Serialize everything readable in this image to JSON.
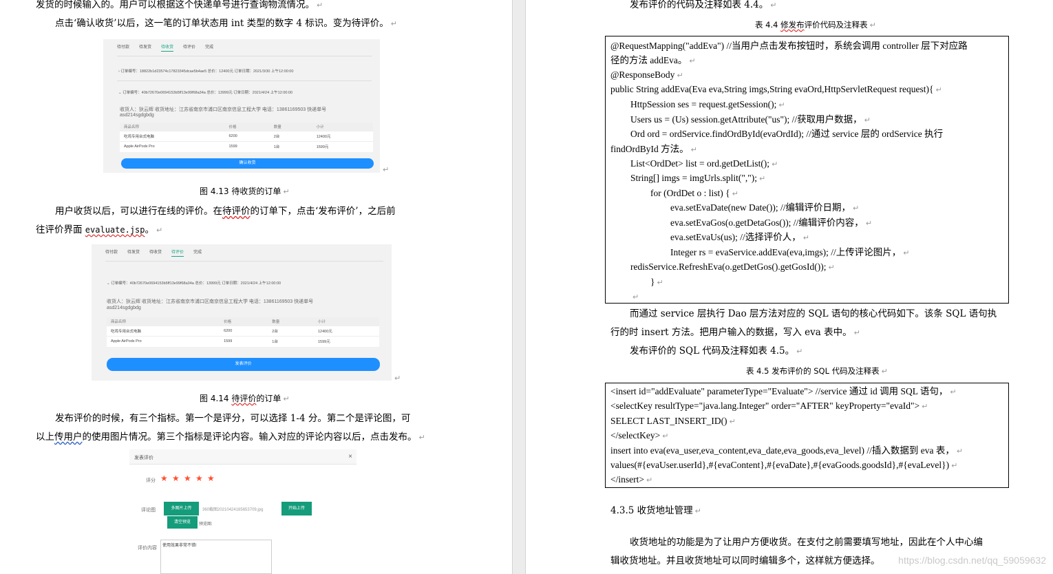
{
  "left": {
    "line1": "发货的时候输入的。用户可以根据这个快递单号进行查询物流情况。",
    "line2": "点击‘确认收货’以后，这一笔的订单状态用 int 类型的数字 4 标识。变为待评价。",
    "fig1": {
      "tabs": [
        "待付款",
        "待发货",
        "待收货",
        "待评价",
        "完成"
      ],
      "row1": "› 订单编号：18822b1d23574c17823345dcae5b4ae5  总价：12400元 订单日期：2021/3/30 上午12:00:00",
      "row2": "⌄ 订单编号：40b72670e0694153b5ff13e99f68a34a  总价：13999元 订单日期：2021/4/24 上午12:00:00",
      "addr1": "收货人：狄云辉  收货地址：江苏省南京市浦口区南京信息工程大学 电话：13861169503 快递单号",
      "addr2": "asd214sgdgbdg",
      "headers": [
        "商品名称",
        "价格",
        "数量",
        "小计"
      ],
      "rows": [
        [
          "吃鸡专用台式电脑",
          "6200",
          "2台",
          "12400元"
        ],
        [
          "Apple AirPods Pro",
          "1599",
          "1台",
          "1599元"
        ]
      ],
      "button": "确认收货"
    },
    "cap1": "图 4.13  待收货的订单",
    "line3": "用户收货以后，可以进行在线的评价。在",
    "line3_wavy": "待评价",
    "line3_end": "的订单下，点击‘发布评价’，之后前",
    "line4": "往评价界面 ",
    "line4_link": "evaluate.jsp",
    "line4_end": "。",
    "fig2": {
      "tabs": [
        "待付款",
        "待发货",
        "待收货",
        "待评价",
        "完成"
      ],
      "row1": "⌄ 订单编号：40b72670e0694153b5ff13e99f68a34a  总价：13999元 订单日期：2021/4/24 上午12:00:00",
      "addr1": "收货人：狄云辉  收货地址：江苏省南京市浦口区南京信息工程大学 电话：13861169503 快递单号",
      "addr2": "asd214sgdgbdg",
      "headers": [
        "商品名称",
        "价格",
        "数量",
        "小计"
      ],
      "rows": [
        [
          "吃鸡专用台式电脑",
          "6200",
          "2台",
          "12400元"
        ],
        [
          "Apple AirPods Pro",
          "1599",
          "1台",
          "1599元"
        ]
      ],
      "button": "发表评价"
    },
    "cap2a": "图 4.14  ",
    "cap2_wavy": "待评价",
    "cap2b": "的订单",
    "line5": "发布评价的时候，有三个指标。第一个是评分，可以选择 1-4 分。第二个是评论图，可",
    "line6a": "以上",
    "line6_wavy": "传用户",
    "line6b": "的使用图片情况。第三个指标是评论内容。输入对应的评论内容以后，点击发布。",
    "form": {
      "title": "发表评价",
      "close": "×",
      "score_label": "评分",
      "stars": [
        "★",
        "★",
        "★",
        "★",
        "★"
      ],
      "pic_label": "评论图",
      "multi_upload": "多图片上传",
      "filename": "360截图20210424165653709.jpg",
      "start_upload": "开始上传",
      "clear_preview": "清空预览",
      "preview": "预览图:",
      "content_label": "评价内容",
      "content_value": "使用效果非常不错!"
    }
  },
  "right": {
    "top": "发布评价的代码及注释如表 4.4。",
    "tcap1a": "表 4.4  ",
    "tcap1_wavy": "修发布",
    "tcap1b": "评价代码及注释表",
    "code1": [
      {
        "t": "@RequestMapping(\"addEva\")    //当用户点击发布按钮时，系统会调用 controller 层下对应路"
      },
      {
        "t": "径的方法 addEva。"
      },
      {
        "t": "@ResponseBody"
      },
      {
        "t": "public String addEva(Eva eva,String imgs,String evaOrd,HttpServletRequest request){"
      },
      {
        "t": "HttpSession ses = request.getSession();"
      },
      {
        "t": "Users us = (Us) session.getAttribute(\"us\");    //获取用户数据，"
      },
      {
        "t": "Ord ord = ordService.findOrdById(evaOrdId);    //通过 service 层的 ordService 执行"
      },
      {
        "t": "findOrdById 方法。"
      },
      {
        "t": "List<OrdDet> list = ord.getDetList();"
      },
      {
        "t": "String[] imgs = imgUrls.split(\",\");"
      },
      {
        "t": "for (OrdDet o : list) {"
      },
      {
        "t": "eva.setEvaDate(new Date());    //编辑评价日期，"
      },
      {
        "t": "eva.setEvaGos(o.getDetaGos()); //编辑评价内容，"
      },
      {
        "t": "eva.setEvaUs(us);                 //选择评价人，"
      },
      {
        "t": "Integer rs = evaService.addEva(eva,imgs); //上传评论图片，"
      },
      {
        "t": "redisService.RefreshEva(o.getDetGos().getGosId());"
      },
      {
        "t": "}"
      },
      {
        "t": ""
      }
    ],
    "p1a": "而通过 service 层执行 Dao 层方法对应的 SQL 语句的核心代码如下。该条 SQL 语句执",
    "p1b": "行的时 insert 方法。把用户输入的数据，写入 eva 表中。",
    "p2": "发布评价的 SQL 代码及注释如表 4.5。",
    "tcap2": "表 4.5 发布评价的 SQL 代码及注释表",
    "code2": [
      {
        "t": "<insert id=\"addEvaluate\" parameterType=\"Evaluate\">    //service 通过 id 调用 SQL 语句，"
      },
      {
        "t": "<selectKey resultType=\"java.lang.Integer\" order=\"AFTER\" keyProperty=\"evaId\">"
      },
      {
        "t": "SELECT LAST_INSERT_ID()"
      },
      {
        "t": "</selectKey>"
      },
      {
        "t": "insert into eva(eva_user,eva_content,eva_date,eva_goods,eva_level) //插入数据到 eva 表，"
      },
      {
        "t": "values(#{evaUser.userId},#{evaContent},#{evaDate},#{evaGoods.goodsId},#{evaLevel})"
      },
      {
        "t": "</insert>"
      }
    ],
    "section": "4.3.5 收货地址管理",
    "p3a": "收货地址的功能是为了让用户方便收货。在支付之前需要填写地址，因此在个人中心编",
    "p3b": "辑收货地址。并且收货地址可以同时编辑多个，这样就方便选择。",
    "watermark": "https://blog.csdn.net/qq_59059632"
  },
  "colors": {
    "accent_green": "#159c7a",
    "tab_green": "#1aa385",
    "button_blue": "#1e8fff",
    "star_red": "#ff4f2f",
    "wavy_red": "#d33"
  }
}
